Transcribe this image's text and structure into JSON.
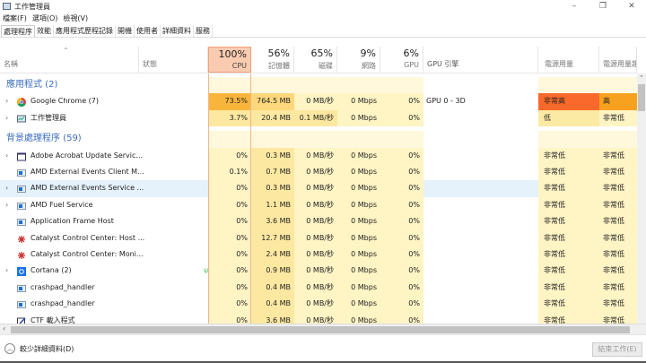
{
  "window": {
    "title": "工作管理員",
    "controls": [
      "–",
      "❐",
      "✕"
    ]
  },
  "menu": [
    "檔案(F)",
    "選項(O)",
    "檢視(V)"
  ],
  "tabs": [
    "處理程序",
    "效能",
    "應用程式歷程記錄",
    "開機",
    "使用者",
    "詳細資料",
    "服務"
  ],
  "columns": {
    "name": "名稱",
    "status": "狀態",
    "cpu": {
      "pct": "100%",
      "label": "CPU"
    },
    "memory": {
      "pct": "56%",
      "label": "記憶體"
    },
    "disk": {
      "pct": "65%",
      "label": "磁碟"
    },
    "network": {
      "pct": "9%",
      "label": "網路"
    },
    "gpu": {
      "pct": "6%",
      "label": "GPU"
    },
    "gpu_engine": "GPU 引擎",
    "power": "電源用量",
    "power_trend": "電源用量趨勢"
  },
  "groups": {
    "apps": "應用程式 (2)",
    "background": "背景處理程序 (59)"
  },
  "apps": [
    {
      "name": "Google Chrome (7)",
      "icon": "chrome-icon",
      "expand": true,
      "cpu": "73.5%",
      "mem": "764.5 MB",
      "disk": "0 MB/秒",
      "net": "0 Mbps",
      "gpu": "0%",
      "engine": "GPU 0 - 3D",
      "power": "非常高",
      "trend": "高",
      "heat": [
        4,
        3,
        1,
        1,
        1
      ],
      "pw": "pw-vh",
      "tw": "pw-h"
    },
    {
      "name": "工作管理員",
      "icon": "task-manager-icon",
      "expand": true,
      "cpu": "3.7%",
      "mem": "20.4 MB",
      "disk": "0.1 MB/秒",
      "net": "0 Mbps",
      "gpu": "0%",
      "engine": "",
      "power": "低",
      "trend": "非常低",
      "heat": [
        2,
        2,
        2,
        1,
        1
      ],
      "pw": "pw-l",
      "tw": "pw-vl"
    }
  ],
  "background": [
    {
      "name": "Adobe Acrobat Update Servic...",
      "icon": "window-icon",
      "expand": true,
      "cpu": "0%",
      "mem": "0.3 MB",
      "disk": "0 MB/秒",
      "net": "0 Mbps",
      "gpu": "0%",
      "power": "非常低",
      "trend": "非常低"
    },
    {
      "name": "AMD External Events Client M...",
      "icon": "service-icon",
      "expand": false,
      "cpu": "0.1%",
      "mem": "0.7 MB",
      "disk": "0 MB/秒",
      "net": "0 Mbps",
      "gpu": "0%",
      "power": "非常低",
      "trend": "非常低"
    },
    {
      "name": "AMD External Events Service ...",
      "icon": "service-icon",
      "expand": true,
      "cpu": "0%",
      "mem": "0.3 MB",
      "disk": "0 MB/秒",
      "net": "0 Mbps",
      "gpu": "0%",
      "power": "非常低",
      "trend": "非常低",
      "selected": true
    },
    {
      "name": "AMD Fuel Service",
      "icon": "service-icon",
      "expand": true,
      "cpu": "0%",
      "mem": "1.1 MB",
      "disk": "0 MB/秒",
      "net": "0 Mbps",
      "gpu": "0%",
      "power": "非常低",
      "trend": "非常低"
    },
    {
      "name": "Application Frame Host",
      "icon": "service-icon",
      "expand": false,
      "cpu": "0%",
      "mem": "3.6 MB",
      "disk": "0 MB/秒",
      "net": "0 Mbps",
      "gpu": "0%",
      "power": "非常低",
      "trend": "非常低"
    },
    {
      "name": "Catalyst Control Center: Host ...",
      "icon": "catalyst-icon",
      "expand": false,
      "cpu": "0%",
      "mem": "12.7 MB",
      "disk": "0 MB/秒",
      "net": "0 Mbps",
      "gpu": "0%",
      "power": "非常低",
      "trend": "非常低"
    },
    {
      "name": "Catalyst Control Center: Moni...",
      "icon": "catalyst-icon",
      "expand": false,
      "cpu": "0%",
      "mem": "2.4 MB",
      "disk": "0 MB/秒",
      "net": "0 Mbps",
      "gpu": "0%",
      "power": "非常低",
      "trend": "非常低"
    },
    {
      "name": "Cortana (2)",
      "icon": "cortana-icon",
      "expand": true,
      "status_icon": "leaf-icon",
      "cpu": "0%",
      "mem": "0.9 MB",
      "disk": "0 MB/秒",
      "net": "0 Mbps",
      "gpu": "0%",
      "power": "非常低",
      "trend": "非常低"
    },
    {
      "name": "crashpad_handler",
      "icon": "service-icon",
      "expand": false,
      "cpu": "0%",
      "mem": "0.4 MB",
      "disk": "0 MB/秒",
      "net": "0 Mbps",
      "gpu": "0%",
      "power": "非常低",
      "trend": "非常低"
    },
    {
      "name": "crashpad_handler",
      "icon": "service-icon",
      "expand": false,
      "cpu": "0%",
      "mem": "0.4 MB",
      "disk": "0 MB/秒",
      "net": "0 Mbps",
      "gpu": "0%",
      "power": "非常低",
      "trend": "非常低"
    },
    {
      "name": "CTF 載入程式",
      "icon": "ctf-icon",
      "expand": false,
      "cpu": "0%",
      "mem": "3.6 MB",
      "disk": "0 MB/秒",
      "net": "0 Mbps",
      "gpu": "0%",
      "power": "非常低",
      "trend": "非常低"
    }
  ],
  "footer": {
    "fewer_details": "較少詳細資料(D)",
    "end_task": "結束工作(E)"
  }
}
